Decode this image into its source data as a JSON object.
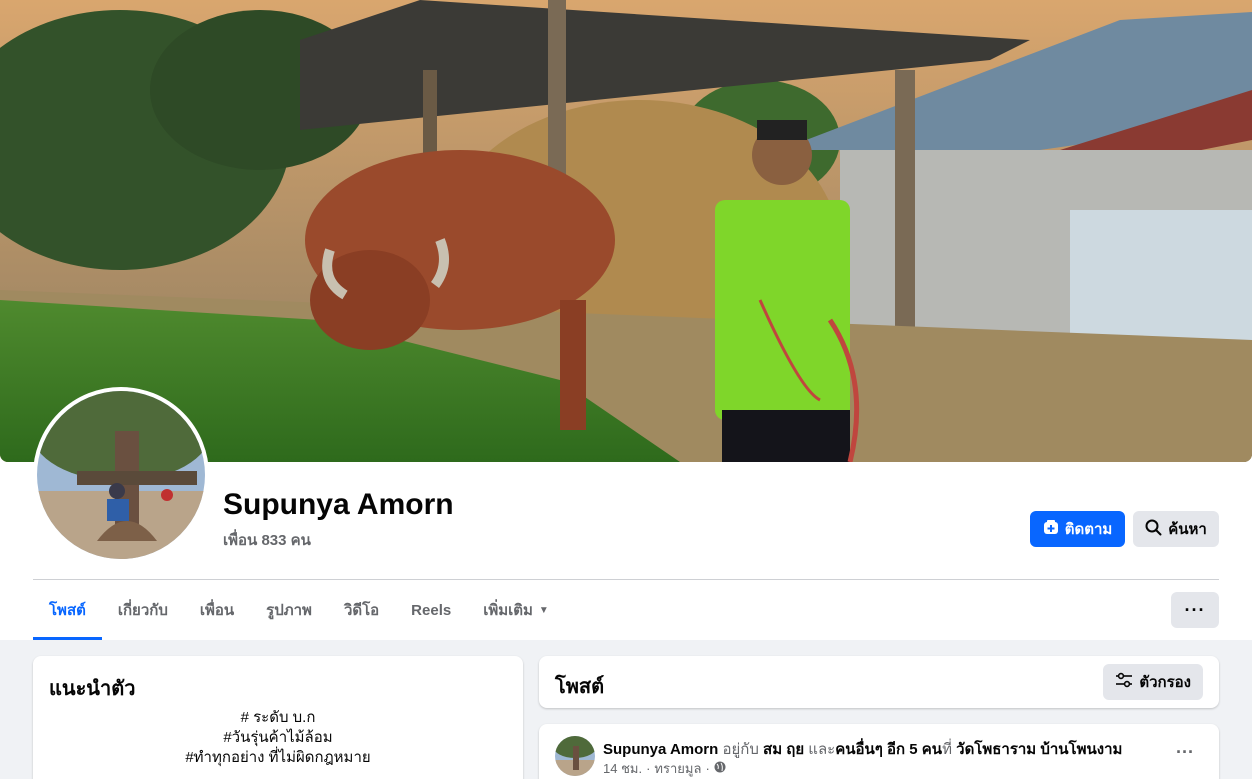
{
  "profile": {
    "name": "Supunya Amorn",
    "friends": "เพื่อน 833 คน"
  },
  "actions": {
    "follow": "ติดตาม",
    "search": "ค้นหา"
  },
  "tabs": [
    {
      "label": "โพสต์"
    },
    {
      "label": "เกี่ยวกับ"
    },
    {
      "label": "เพื่อน"
    },
    {
      "label": "รูปภาพ"
    },
    {
      "label": "วิดีโอ"
    },
    {
      "label": "Reels"
    },
    {
      "label": "เพิ่มเติม"
    }
  ],
  "more_menu": "···",
  "intro": {
    "title": "แนะนำตัว",
    "bio": [
      "# ระดับ บ.ก",
      "#วันรุ่นค้าไม้ล้อม",
      "#ทำทุกอย่าง ที่ไม่ผิดกฎหมาย"
    ]
  },
  "posts_header": {
    "title": "โพสต์",
    "filter": "ตัวกรอง"
  },
  "post": {
    "author": "Supunya Amorn",
    "with_text": " อยู่กับ ",
    "tagged": "สม ฤย",
    "and_text": " และ",
    "others": "คนอื่นๆ อีก 5 คน",
    "at_text": "ที่ ",
    "place": "วัดโพธาราม บ้านโพนงาม",
    "time": "14 ชม.",
    "sep": " · ",
    "location": "ทรายมูล",
    "sep2": " · ",
    "more": "···"
  },
  "icons": {
    "follow": "follow-plus-icon",
    "search": "search-icon",
    "filter": "filter-icon",
    "privacy": "globe-icon",
    "dropdown": "caret-down-icon"
  },
  "colors": {
    "brand": "#0866ff",
    "secondary_bg": "#e4e6eb",
    "page_bg": "#f0f2f5",
    "muted_text": "#65676b"
  }
}
